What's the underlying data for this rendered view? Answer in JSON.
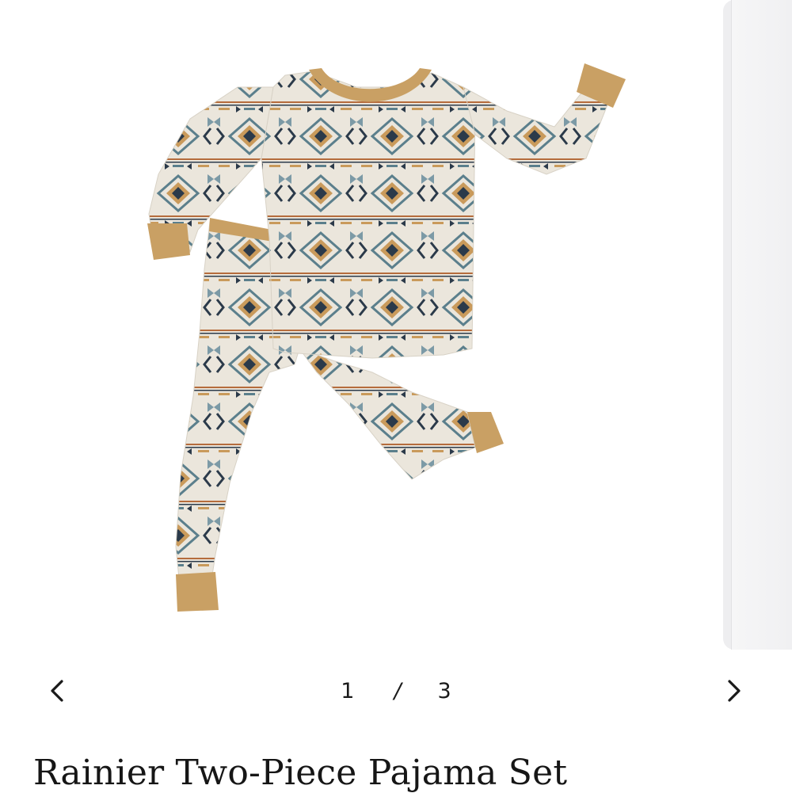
{
  "product": {
    "title": "Rainier Two-Piece Pajama Set",
    "image": {
      "subject": "pajama-set",
      "colors": {
        "base": "#ebe6dc",
        "cuff": "#c9a064",
        "teal": "#5b7f8c",
        "navy": "#2b3a4a",
        "rust": "#b56c3c",
        "tan": "#c99a5b"
      }
    }
  },
  "gallery": {
    "current": "1",
    "separator": "/",
    "total": "3",
    "prev_icon": "chevron-left-icon",
    "next_icon": "chevron-right-icon"
  }
}
